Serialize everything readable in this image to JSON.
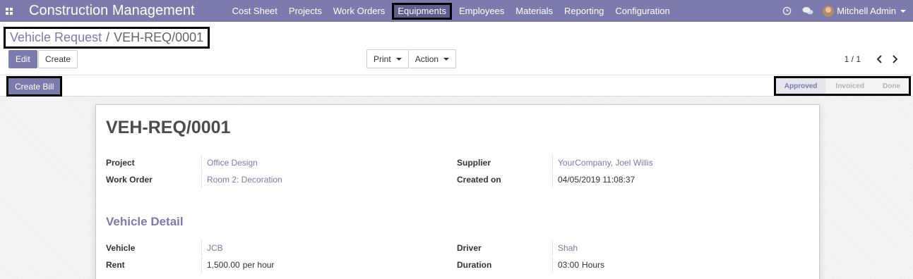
{
  "app": {
    "brand": "Construction Management",
    "menu": [
      "Cost Sheet",
      "Projects",
      "Work Orders",
      "Equipments",
      "Employees",
      "Materials",
      "Reporting",
      "Configuration"
    ],
    "active_menu": "Equipments",
    "user": "Mitchell Admin",
    "accent_color": "#7c7bad"
  },
  "breadcrumb": {
    "parent": "Vehicle Request",
    "separator": "/",
    "current": "VEH-REQ/0001"
  },
  "controls": {
    "edit_label": "Edit",
    "create_label": "Create",
    "print_label": "Print",
    "action_label": "Action",
    "pager": "1 / 1"
  },
  "statusbar": {
    "create_bill_label": "Create Bill",
    "stages": [
      "Approved",
      "Invoiced",
      "Done"
    ],
    "current_stage": "Approved"
  },
  "form": {
    "title": "VEH-REQ/0001",
    "fields": {
      "project": {
        "label": "Project",
        "value": "Office Design"
      },
      "work_order": {
        "label": "Work Order",
        "value": "Room 2: Decoration"
      },
      "supplier": {
        "label": "Supplier",
        "value": "YourCompany, Joel Willis"
      },
      "created_on": {
        "label": "Created on",
        "value": "04/05/2019 11:08:37"
      }
    },
    "section_title": "Vehicle Detail",
    "vehicle_fields": {
      "vehicle": {
        "label": "Vehicle",
        "value": "JCB"
      },
      "rent": {
        "label": "Rent",
        "value": "1,500.00",
        "unit": "per hour"
      },
      "driver": {
        "label": "Driver",
        "value": "Shah"
      },
      "duration": {
        "label": "Duration",
        "value": "03:00",
        "unit": "Hours"
      }
    }
  }
}
